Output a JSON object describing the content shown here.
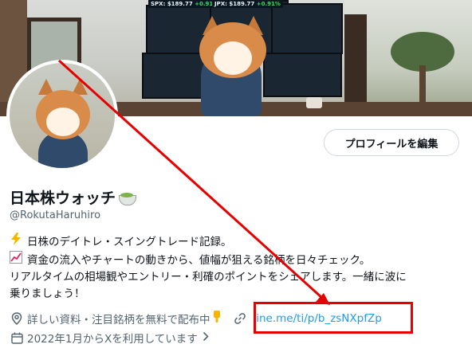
{
  "banner": {
    "tickers": [
      {
        "symbol": "SPX:",
        "price": "$189.77",
        "change": "+0.91%"
      },
      {
        "symbol": "JPX:",
        "price": "$189.77",
        "change": "+0.91%"
      }
    ]
  },
  "profile": {
    "edit_button": "プロフィールを編集",
    "name": "日本株ウォッチ",
    "handle": "@RokutaHaruhiro",
    "bio_lines": [
      "日株のデイトレ・スイングトレード記録。",
      "資金の流入やチャートの動きから、値幅が狙える銘柄を日々チェック。",
      "リアルタイムの相場観やエントリー・利確のポイントをシェアします。一緒に波に",
      "乗りましょう！"
    ],
    "location": "詳しい資料・注目銘柄を無料で配布中",
    "link": "line.me/ti/p/b_zsNXpfZp",
    "joined": "2022年1月からXを利用しています"
  },
  "icons": {
    "bio_line1": "lightning-icon",
    "bio_line2": "chart-increasing-icon",
    "location": "location-pin-icon",
    "link": "link-icon",
    "joined": "calendar-icon",
    "name": "matcha-icon",
    "point": "pointing-down-icon",
    "chevron": "chevron-right-icon"
  },
  "colors": {
    "link": "#1d9bf0",
    "secondary_text": "#536471",
    "annotation": "#e60000"
  }
}
